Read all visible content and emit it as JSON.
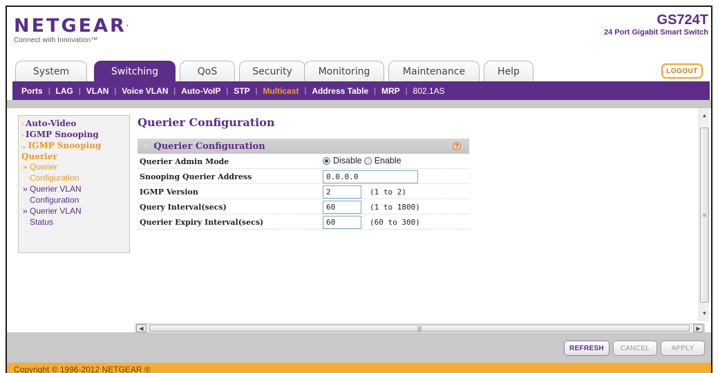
{
  "header": {
    "brand": "NETGEAR",
    "tagline": "Connect with Innovation",
    "model": "GS724T",
    "model_desc": "24 Port Gigabit Smart Switch"
  },
  "tabs": [
    {
      "label": "System",
      "active": false
    },
    {
      "label": "Switching",
      "active": true
    },
    {
      "label": "QoS",
      "active": false
    },
    {
      "label": "Security",
      "active": false
    },
    {
      "label": "Monitoring",
      "active": false
    },
    {
      "label": "Maintenance",
      "active": false
    },
    {
      "label": "Help",
      "active": false
    }
  ],
  "logout_label": "LOGOUT",
  "submenu": [
    {
      "label": "Ports",
      "active": false
    },
    {
      "label": "LAG",
      "active": false
    },
    {
      "label": "VLAN",
      "active": false
    },
    {
      "label": "Voice VLAN",
      "active": false
    },
    {
      "label": "Auto-VoIP",
      "active": false
    },
    {
      "label": "STP",
      "active": false
    },
    {
      "label": "Multicast",
      "active": true
    },
    {
      "label": "Address Table",
      "active": false
    },
    {
      "label": "MRP",
      "active": false
    },
    {
      "label": "802.1AS",
      "active": false
    }
  ],
  "leftnav": {
    "auto_video": "Auto-Video",
    "igmp_snooping": "IGMP Snooping",
    "igmp_querier_1": "IGMP Snooping",
    "igmp_querier_2": "Querier",
    "sub1_a": "Querier",
    "sub1_b": "Configuration",
    "sub2_a": "Querier VLAN",
    "sub2_b": "Configuration",
    "sub3_a": "Querier VLAN",
    "sub3_b": "Status"
  },
  "page_title": "Querier Configuration",
  "panel": {
    "title": "Querier Configuration",
    "help": "?",
    "admin_mode_label": "Querier Admin Mode",
    "disable_label": "Disable",
    "enable_label": "Enable",
    "admin_mode_value": "Disable",
    "address_label": "Snooping Querier Address",
    "address_value": "0.0.0.0",
    "version_label": "IGMP Version",
    "version_value": "2",
    "version_range": "(1 to 2)",
    "interval_label": "Query Interval(secs)",
    "interval_value": "60",
    "interval_range": "(1 to 1800)",
    "expiry_label": "Querier Expiry Interval(secs)",
    "expiry_value": "60",
    "expiry_range": "(60 to 300)"
  },
  "buttons": {
    "refresh": "REFRESH",
    "cancel": "CANCEL",
    "apply": "APPLY"
  },
  "copyright": "Copyright © 1996-2012 NETGEAR ®",
  "colors": {
    "brand_purple": "#5d2e89",
    "accent_orange": "#f19a18"
  }
}
